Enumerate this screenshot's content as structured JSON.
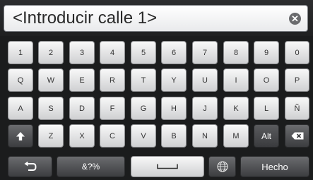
{
  "search": {
    "placeholder": "<Introducir calle 1>"
  },
  "keyboard": {
    "row1": [
      "1",
      "2",
      "3",
      "4",
      "5",
      "6",
      "7",
      "8",
      "9",
      "0"
    ],
    "row2": [
      "Q",
      "W",
      "E",
      "R",
      "T",
      "Y",
      "U",
      "I",
      "O",
      "P"
    ],
    "row3": [
      "A",
      "S",
      "D",
      "F",
      "G",
      "H",
      "J",
      "K",
      "L",
      "Ñ"
    ],
    "row4": [
      "Z",
      "X",
      "C",
      "V",
      "B",
      "N",
      "M"
    ],
    "alt_label": "Alt",
    "symbols_label": "&?%",
    "done_label": "Hecho"
  },
  "icons": {
    "clear": "clear-x-icon",
    "shift": "shift-up-arrow-icon",
    "backspace": "backspace-icon",
    "back": "back-arrow-icon",
    "space": "space-bar-icon",
    "language": "globe-icon"
  }
}
